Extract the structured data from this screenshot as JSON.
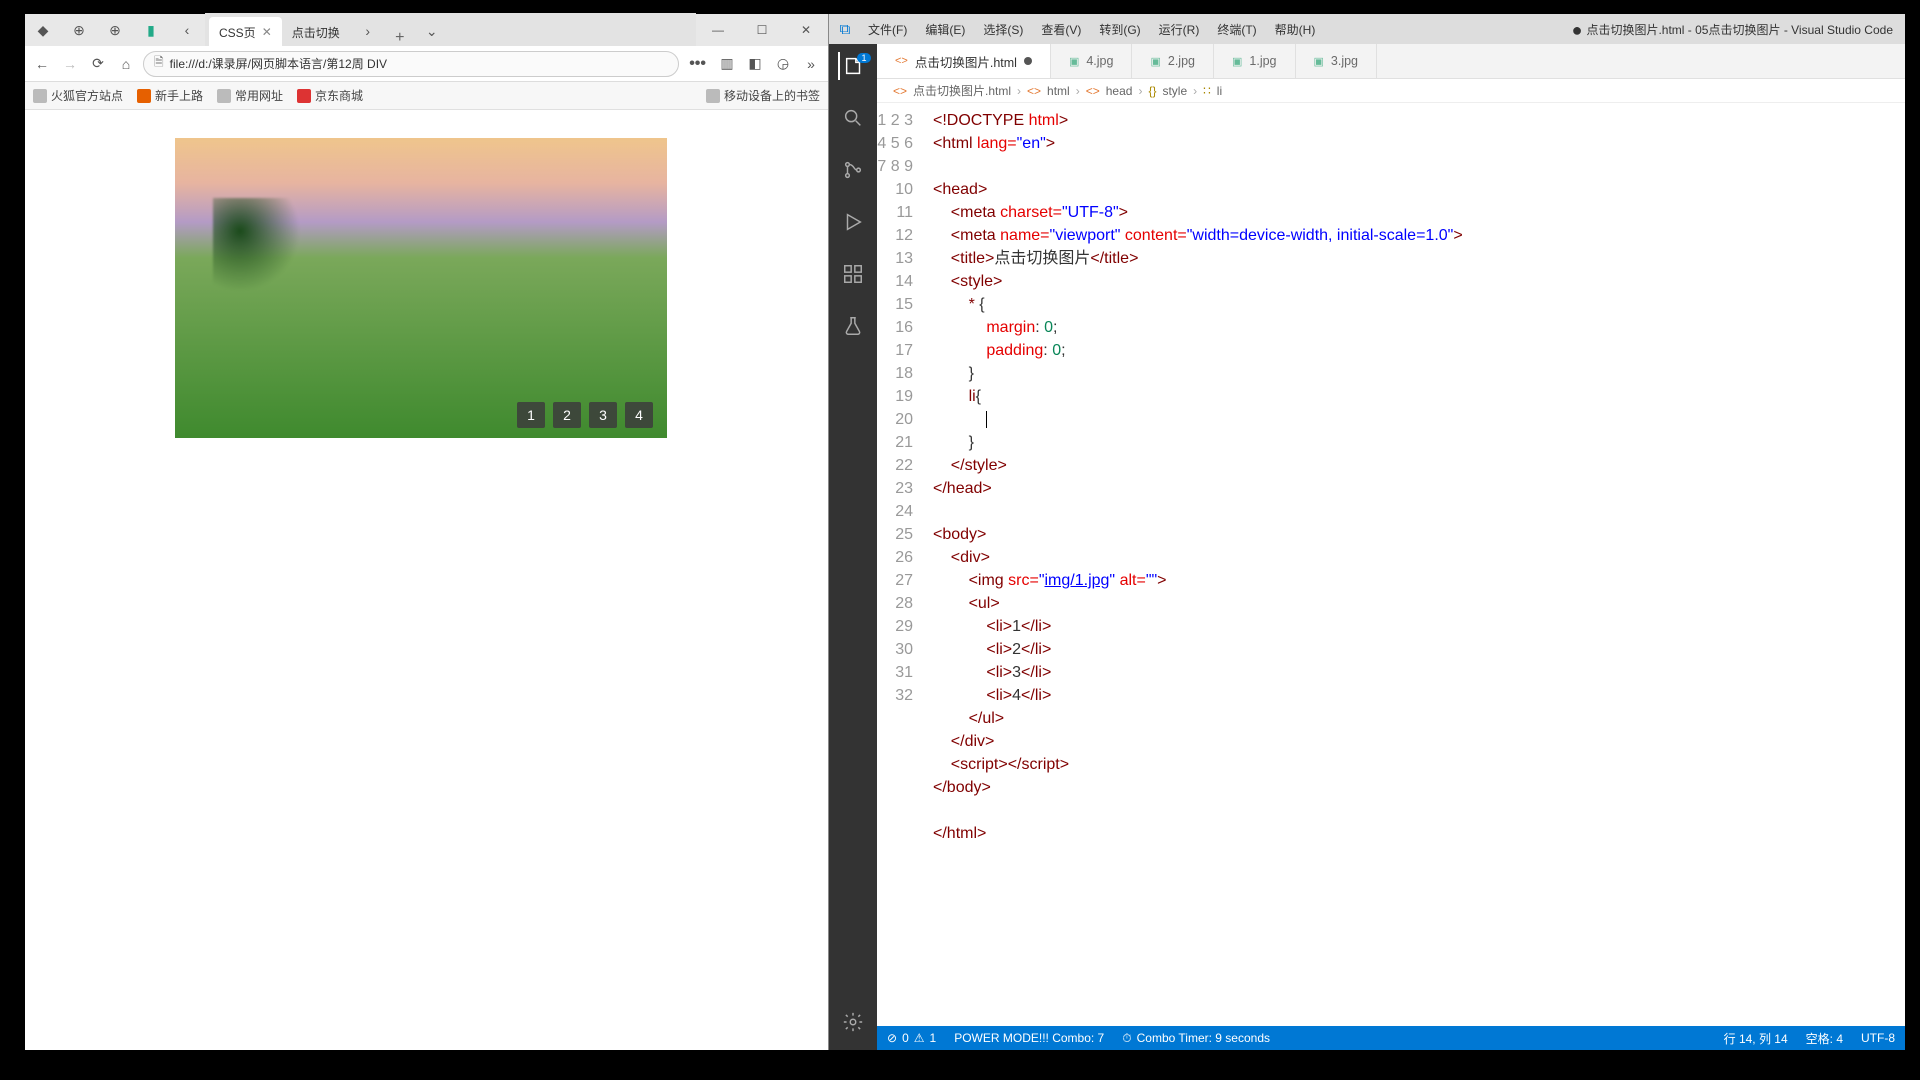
{
  "browser": {
    "tabs": [
      {
        "label": "CSS页",
        "active": true
      },
      {
        "label": "点击切换",
        "active": false
      }
    ],
    "url": "file:///d:/课录屏/网页脚本语言/第12周 DIV",
    "bookmarks": [
      "火狐官方站点",
      "新手上路",
      "常用网址",
      "京东商城"
    ],
    "bookmarks_right": "移动设备上的书签",
    "gallery_numbers": [
      "1",
      "2",
      "3",
      "4"
    ]
  },
  "vscode": {
    "menus": [
      "文件(F)",
      "编辑(E)",
      "选择(S)",
      "查看(V)",
      "转到(G)",
      "运行(R)",
      "终端(T)",
      "帮助(H)"
    ],
    "window_title": "点击切换图片.html - 05点击切换图片 - Visual Studio Code",
    "tabs": [
      {
        "label": "点击切换图片.html",
        "modified": true,
        "active": true
      },
      {
        "label": "4.jpg"
      },
      {
        "label": "2.jpg"
      },
      {
        "label": "1.jpg"
      },
      {
        "label": "3.jpg"
      }
    ],
    "breadcrumbs": [
      "点击切换图片.html",
      "html",
      "head",
      "style",
      "li"
    ],
    "code": {
      "l1": "<!DOCTYPE html>",
      "l2_open": "<html ",
      "l2_attr": "lang=",
      "l2_val": "\"en\"",
      "l2_close": ">",
      "l4": "<head>",
      "l5_open": "<meta ",
      "l5_a": "charset=",
      "l5_v": "\"UTF-8\"",
      "l5_c": ">",
      "l6_open": "<meta ",
      "l6_a1": "name=",
      "l6_v1": "\"viewport\" ",
      "l6_a2": "content=",
      "l6_v2": "\"width=device-width, initial-scale=1.0\"",
      "l6_c": ">",
      "l7_open": "<title>",
      "l7_txt": "点击切换图片",
      "l7_close": "</title>",
      "l8": "<style>",
      "l9": "* {",
      "l10_p": "margin",
      "l10_v": "0",
      "l11_p": "padding",
      "l11_v": "0",
      "l12": "}",
      "l13": "li{",
      "l15": "}",
      "l16": "</style>",
      "l17": "</head>",
      "l19": "<body>",
      "l20": "<div>",
      "l21_open": "<img ",
      "l21_a": "src=",
      "l21_v": "\"",
      "l21_link": "img/1.jpg",
      "l21_v2": "\" ",
      "l21_a2": "alt=",
      "l21_v3": "\"\"",
      "l21_c": ">",
      "l22": "<ul>",
      "l23": "<li>1</li>",
      "l24": "<li>2</li>",
      "l25": "<li>3</li>",
      "l26": "<li>4</li>",
      "l27": "</ul>",
      "l28": "</div>",
      "l29": "<script></scr",
      "l29b": "ipt>",
      "l30": "</body>",
      "l32": "</html>"
    },
    "status": {
      "errors": "0",
      "warnings": "1",
      "power": "POWER MODE!!! Combo: 7",
      "timer": "Combo Timer: 9 seconds",
      "pos": "行 14, 列 14",
      "spaces": "空格: 4",
      "enc": "UTF-8"
    }
  }
}
